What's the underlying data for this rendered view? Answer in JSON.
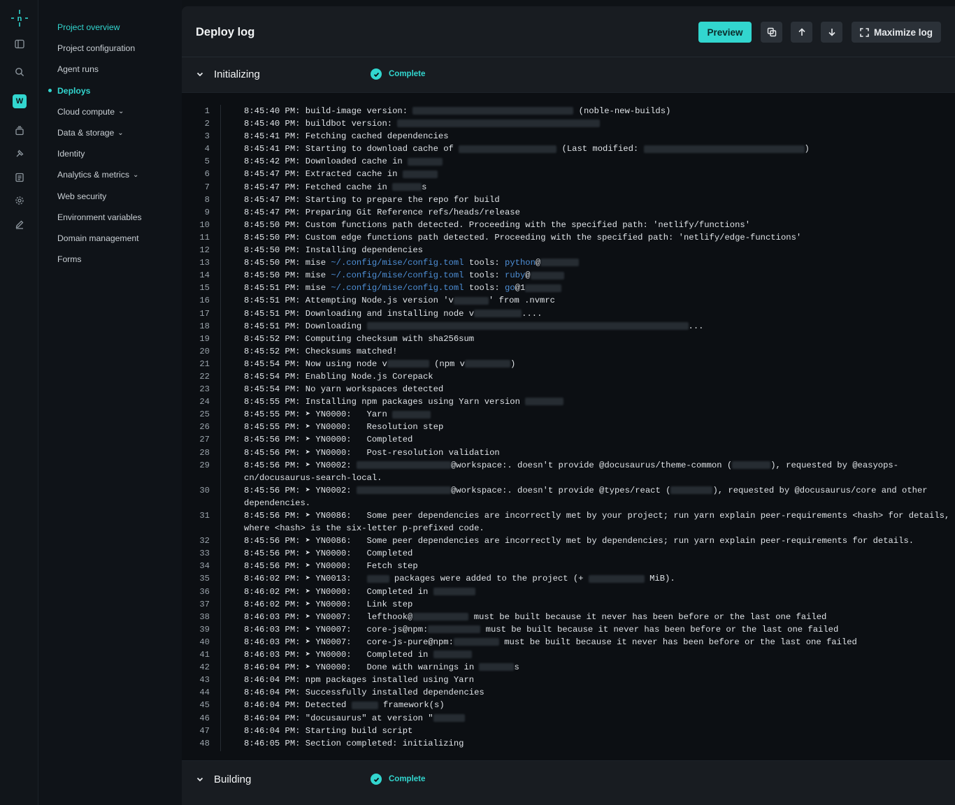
{
  "nav": {
    "items": [
      {
        "label": "Project overview",
        "state": "active"
      },
      {
        "label": "Project configuration"
      },
      {
        "label": "Agent runs"
      },
      {
        "label": "Deploys",
        "state": "current"
      },
      {
        "label": "Cloud compute",
        "chevron": true
      },
      {
        "label": "Data & storage",
        "chevron": true
      },
      {
        "label": "Identity"
      },
      {
        "label": "Analytics & metrics",
        "chevron": true
      },
      {
        "label": "Web security"
      },
      {
        "label": "Environment variables"
      },
      {
        "label": "Domain management"
      },
      {
        "label": "Forms"
      }
    ],
    "workspace_initial": "W"
  },
  "header": {
    "title": "Deploy log",
    "preview_label": "Preview",
    "maximize_label": "Maximize log"
  },
  "sections": [
    {
      "name": "Initializing",
      "status": "Complete"
    },
    {
      "name": "Building",
      "status": "Complete"
    }
  ],
  "colors": {
    "accent": "#32d6cf",
    "panel": "#181c21",
    "log_bg": "#0c0f13"
  },
  "log": [
    {
      "n": "1",
      "t": "8:45:40 PM: build-image version: ",
      "b": [
        230
      ],
      "t2": " (noble-new-builds)"
    },
    {
      "n": "2",
      "t": "8:45:40 PM: buildbot version: ",
      "b": [
        290
      ]
    },
    {
      "n": "3",
      "t": "8:45:41 PM: Fetching cached dependencies"
    },
    {
      "n": "4",
      "t": "8:45:41 PM: Starting to download cache of ",
      "b": [
        140
      ],
      "t2": " (Last modified: ",
      "b2": [
        230
      ],
      "t3": ")"
    },
    {
      "n": "5",
      "t": "8:45:42 PM: Downloaded cache in ",
      "b": [
        50
      ]
    },
    {
      "n": "6",
      "t": "8:45:47 PM: Extracted cache in ",
      "b": [
        50
      ]
    },
    {
      "n": "7",
      "t": "8:45:47 PM: Fetched cache in ",
      "b": [
        42
      ],
      "t2": "s"
    },
    {
      "n": "8",
      "t": "8:45:47 PM: Starting to prepare the repo for build"
    },
    {
      "n": "9",
      "t": "8:45:47 PM: Preparing Git Reference refs/heads/release"
    },
    {
      "n": "10",
      "t": "8:45:50 PM: Custom functions path detected. Proceeding with the specified path: 'netlify/functions'"
    },
    {
      "n": "11",
      "t": "8:45:50 PM: Custom edge functions path detected. Proceeding with the specified path: 'netlify/edge-functions'"
    },
    {
      "n": "12",
      "t": "8:45:50 PM: Installing dependencies"
    },
    {
      "n": "13",
      "t": "8:45:50 PM: mise ",
      "p": "~/.config/mise/config.toml",
      "t2": " tools: ",
      "p2": "python",
      "t3": "@",
      "b2": [
        55
      ]
    },
    {
      "n": "14",
      "t": "8:45:50 PM: mise ",
      "p": "~/.config/mise/config.toml",
      "t2": " tools: ",
      "p2": "ruby",
      "t3": "@",
      "b2": [
        48
      ]
    },
    {
      "n": "15",
      "t": "8:45:51 PM: mise ",
      "p": "~/.config/mise/config.toml",
      "t2": " tools: ",
      "p2": "go",
      "t3": "@1",
      "b2": [
        52
      ]
    },
    {
      "n": "16",
      "t": "8:45:51 PM: Attempting Node.js version 'v",
      "b": [
        50
      ],
      "t2": "' from .nvmrc"
    },
    {
      "n": "17",
      "t": "8:45:51 PM: Downloading and installing node v",
      "b": [
        68
      ],
      "t2": "...."
    },
    {
      "n": "18",
      "t": "8:45:51 PM: Downloading ",
      "b": [
        460
      ],
      "t2": "..."
    },
    {
      "n": "19",
      "t": "8:45:52 PM: Computing checksum with sha256sum"
    },
    {
      "n": "20",
      "t": "8:45:52 PM: Checksums matched!"
    },
    {
      "n": "21",
      "t": "8:45:54 PM: Now using node v",
      "b": [
        60
      ],
      "t2": " (npm v",
      "b2": [
        65
      ],
      "t3": ")"
    },
    {
      "n": "22",
      "t": "8:45:54 PM: Enabling Node.js Corepack"
    },
    {
      "n": "23",
      "t": "8:45:54 PM: No yarn workspaces detected"
    },
    {
      "n": "24",
      "t": "8:45:55 PM: Installing npm packages using Yarn version ",
      "b": [
        55
      ]
    },
    {
      "n": "25",
      "t": "8:45:55 PM: ➤ YN0000:   Yarn ",
      "b": [
        55
      ]
    },
    {
      "n": "26",
      "t": "8:45:55 PM: ➤ YN0000:   Resolution step"
    },
    {
      "n": "27",
      "t": "8:45:56 PM: ➤ YN0000:   Completed"
    },
    {
      "n": "28",
      "t": "8:45:56 PM: ➤ YN0000:   Post-resolution validation"
    },
    {
      "n": "29",
      "t": "8:45:56 PM: ➤ YN0002: ",
      "b": [
        135
      ],
      "t2": "@workspace:. doesn't provide @docusaurus/theme-common (",
      "b2": [
        55
      ],
      "t3": "), requested by @easyops-cn/docusaurus-search-local."
    },
    {
      "n": "30",
      "t": "8:45:56 PM: ➤ YN0002: ",
      "b": [
        135
      ],
      "t2": "@workspace:. doesn't provide @types/react (",
      "b2": [
        60
      ],
      "t3": "), requested by @docusaurus/core and other dependencies."
    },
    {
      "n": "31",
      "t": "8:45:56 PM: ➤ YN0086:   Some peer dependencies are incorrectly met by your project; run yarn explain peer-requirements <hash> for details, where <hash> is the six-letter p-prefixed code."
    },
    {
      "n": "32",
      "t": "8:45:56 PM: ➤ YN0086:   Some peer dependencies are incorrectly met by dependencies; run yarn explain peer-requirements for details."
    },
    {
      "n": "33",
      "t": "8:45:56 PM: ➤ YN0000:   Completed"
    },
    {
      "n": "34",
      "t": "8:45:56 PM: ➤ YN0000:   Fetch step"
    },
    {
      "n": "35",
      "t": "8:46:02 PM: ➤ YN0013:   ",
      "b": [
        32
      ],
      "t2": " packages were added to the project (+ ",
      "b2": [
        80
      ],
      "t3": " MiB)."
    },
    {
      "n": "36",
      "t": "8:46:02 PM: ➤ YN0000:   Completed in ",
      "b": [
        60
      ]
    },
    {
      "n": "37",
      "t": "8:46:02 PM: ➤ YN0000:   Link step"
    },
    {
      "n": "38",
      "t": "8:46:03 PM: ➤ YN0007:   lefthook@",
      "b": [
        80
      ],
      "t2": " must be built because it never has been before or the last one failed"
    },
    {
      "n": "39",
      "t": "8:46:03 PM: ➤ YN0007:   core-js@npm:",
      "b": [
        75
      ],
      "t2": " must be built because it never has been before or the last one failed"
    },
    {
      "n": "40",
      "t": "8:46:03 PM: ➤ YN0007:   core-js-pure@npm:",
      "b": [
        65
      ],
      "t2": " must be built because it never has been before or the last one failed"
    },
    {
      "n": "41",
      "t": "8:46:03 PM: ➤ YN0000:   Completed in ",
      "b": [
        55
      ]
    },
    {
      "n": "42",
      "t": "8:46:04 PM: ➤ YN0000:   Done with warnings in ",
      "b": [
        50
      ],
      "t2": "s"
    },
    {
      "n": "43",
      "t": "8:46:04 PM: npm packages installed using Yarn"
    },
    {
      "n": "44",
      "t": "8:46:04 PM: Successfully installed dependencies"
    },
    {
      "n": "45",
      "t": "8:46:04 PM: Detected ",
      "b": [
        38
      ],
      "t2": " framework(s)"
    },
    {
      "n": "46",
      "t": "8:46:04 PM: \"docusaurus\" at version \"",
      "b": [
        45
      ]
    },
    {
      "n": "47",
      "t": "8:46:04 PM: Starting build script"
    },
    {
      "n": "48",
      "t": "8:46:05 PM: Section completed: initializing"
    }
  ]
}
